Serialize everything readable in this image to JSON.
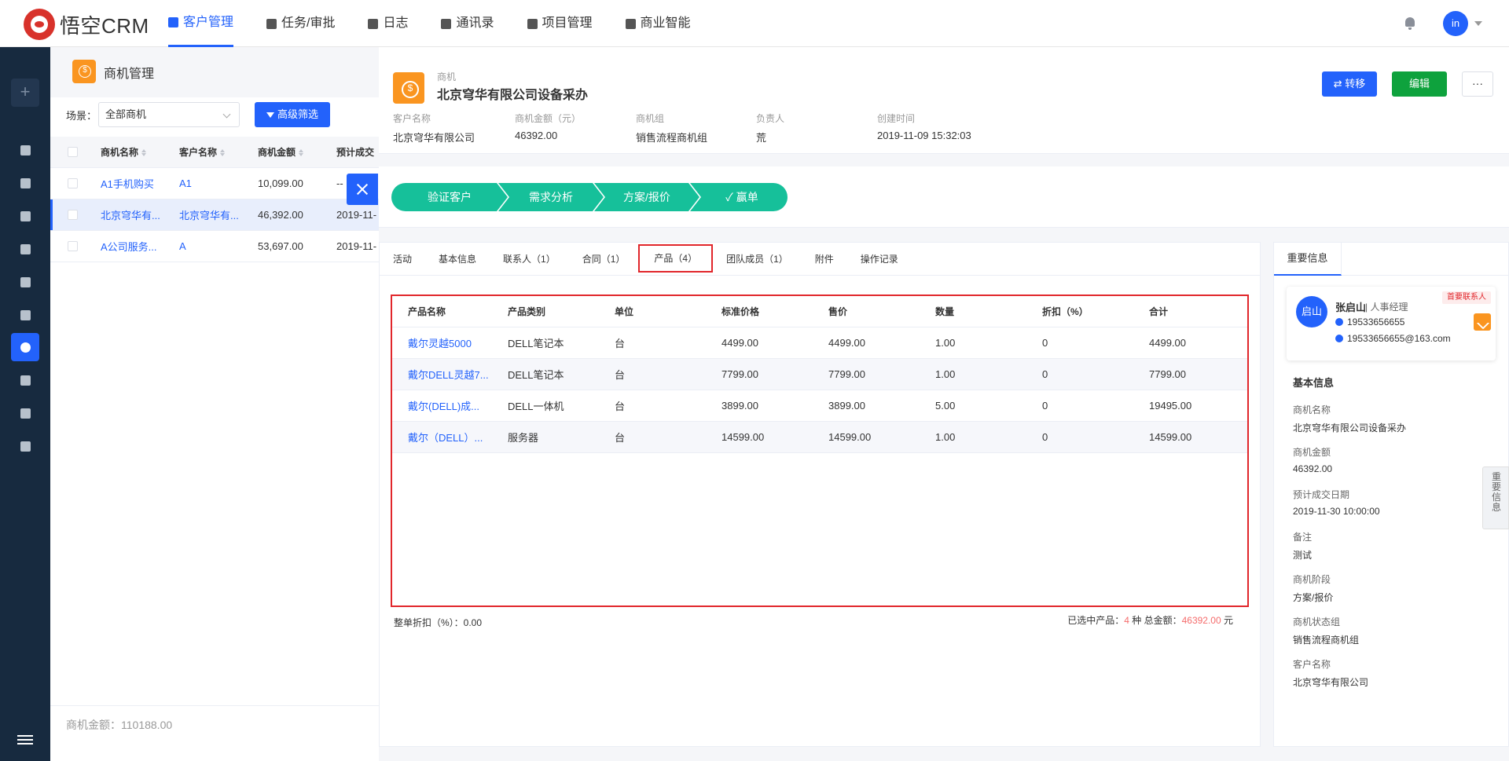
{
  "app": {
    "logo_text": "悟空CRM",
    "avatar_text": "in"
  },
  "topnav": [
    {
      "label": "客户管理",
      "icon": "building-icon",
      "active": true
    },
    {
      "label": "任务/审批",
      "icon": "briefcase-icon",
      "active": false
    },
    {
      "label": "日志",
      "icon": "log-icon",
      "active": false
    },
    {
      "label": "通讯录",
      "icon": "contacts-icon",
      "active": false
    },
    {
      "label": "项目管理",
      "icon": "project-icon",
      "active": false
    },
    {
      "label": "商业智能",
      "icon": "bi-icon",
      "active": false
    }
  ],
  "sidebar": {
    "add_glyph": "+",
    "items": [
      {
        "icon": "dashboard-icon"
      },
      {
        "icon": "chat-icon"
      },
      {
        "icon": "transfer-icon"
      },
      {
        "icon": "company-icon"
      },
      {
        "icon": "contact-card-icon"
      },
      {
        "icon": "wave-icon"
      },
      {
        "icon": "money-icon",
        "active": true
      },
      {
        "icon": "contract-icon"
      },
      {
        "icon": "payment-icon"
      },
      {
        "icon": "product-icon"
      }
    ]
  },
  "list": {
    "title": "商机管理",
    "scene_label": "场景：",
    "scene_value": "全部商机",
    "filter_button": "高级筛选",
    "columns": [
      "商机名称",
      "客户名称",
      "商机金额",
      "预计成交"
    ],
    "rows": [
      {
        "name": "A1手机购买",
        "customer": "A1",
        "amount": "10,099.00",
        "date": "--",
        "selected": false
      },
      {
        "name": "北京穹华有...",
        "customer": "北京穹华有...",
        "amount": "46,392.00",
        "date": "2019-11-",
        "selected": true
      },
      {
        "name": "A公司服务...",
        "customer": "A",
        "amount": "53,697.00",
        "date": "2019-11-",
        "selected": false
      }
    ],
    "footer": "商机金额：110188.00"
  },
  "detail": {
    "type_label": "商机",
    "title": "北京穹华有限公司设备采办",
    "buttons": {
      "transfer": "⇄ 转移",
      "edit": "编辑",
      "more": "···"
    },
    "info": [
      {
        "key": "客户名称",
        "value": "北京穹华有限公司"
      },
      {
        "key": "商机金额（元）",
        "value": "46392.00"
      },
      {
        "key": "商机组",
        "value": "销售流程商机组"
      },
      {
        "key": "负责人",
        "value": "荒"
      },
      {
        "key": "创建时间",
        "value": "2019-11-09 15:32:03"
      }
    ],
    "stages": [
      "验证客户",
      "需求分析",
      "方案/报价",
      "✓  赢单"
    ],
    "stage_color": "#16c09a",
    "tabs": [
      {
        "label": "活动",
        "active": false
      },
      {
        "label": "基本信息",
        "active": false
      },
      {
        "label": "联系人（1）",
        "active": false
      },
      {
        "label": "合同（1）",
        "active": false
      },
      {
        "label": "产品（4）",
        "active": true
      },
      {
        "label": "团队成员（1）",
        "active": false
      },
      {
        "label": "附件",
        "active": false
      },
      {
        "label": "操作记录",
        "active": false
      }
    ],
    "products": {
      "columns": [
        "产品名称",
        "产品类别",
        "单位",
        "标准价格",
        "售价",
        "数量",
        "折扣（%）",
        "合计"
      ],
      "rows": [
        [
          "戴尔灵越5000",
          "DELL笔记本",
          "台",
          "4499.00",
          "4499.00",
          "1.00",
          "0",
          "4499.00"
        ],
        [
          "戴尔DELL灵越7...",
          "DELL笔记本",
          "台",
          "7799.00",
          "7799.00",
          "1.00",
          "0",
          "7799.00"
        ],
        [
          "戴尔(DELL)成...",
          "DELL一体机",
          "台",
          "3899.00",
          "3899.00",
          "5.00",
          "0",
          "19495.00"
        ],
        [
          "戴尔（DELL）...",
          "服务器",
          "台",
          "14599.00",
          "14599.00",
          "1.00",
          "0",
          "14599.00"
        ]
      ],
      "discount_text": "整单折扣（%）：0.00",
      "selected_prefix": "已选中产品：",
      "selected_count": "4",
      "selected_unit": " 种  总金额：",
      "total_amount": "46392.00",
      "total_unit": " 元"
    }
  },
  "important": {
    "tab": "重要信息",
    "contact": {
      "avatar": "启山",
      "name": "张启山",
      "role": "| 人事经理",
      "badge": "首要联系人",
      "phone": "19533656655",
      "email": "19533656655@163.com"
    },
    "basic_title": "基本信息",
    "fields": [
      {
        "key": "商机名称",
        "value": "北京穹华有限公司设备采办"
      },
      {
        "key": "商机金额",
        "value": "46392.00"
      },
      {
        "key": "预计成交日期",
        "value": "2019-11-30 10:00:00"
      },
      {
        "key": "备注",
        "value": "测试"
      },
      {
        "key": "商机阶段",
        "value": "方案/报价"
      },
      {
        "key": "商机状态组",
        "value": "销售流程商机组"
      },
      {
        "key": "客户名称",
        "value": "北京穹华有限公司"
      }
    ],
    "handle_text": "重要信息"
  }
}
